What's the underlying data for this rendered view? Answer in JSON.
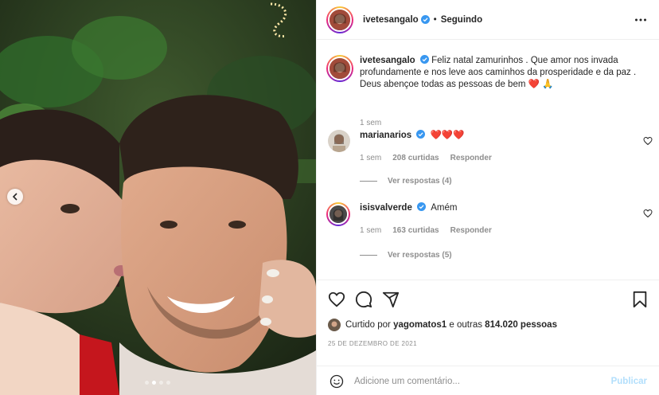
{
  "header": {
    "username": "ivetesangalo",
    "separator": "•",
    "following_label": "Seguindo"
  },
  "caption": {
    "username": "ivetesangalo",
    "text": "Feliz natal zamurinhos . Que amor nos invada profundamente e nos leve aos caminhos da prosperidade e da paz . Deus abençoe todas as pessoas de bem",
    "emojis": "❤️ 🙏",
    "time": "1 sem"
  },
  "comments": [
    {
      "username": "marianarios",
      "text": "❤️❤️❤️",
      "time": "1 sem",
      "likes": "208 curtidas",
      "reply_label": "Responder",
      "view_replies": "Ver respostas (4)"
    },
    {
      "username": "isisvalverde",
      "text": "Amém",
      "time": "1 sem",
      "likes": "163 curtidas",
      "reply_label": "Responder",
      "view_replies": "Ver respostas (5)"
    }
  ],
  "likes": {
    "prefix": "Curtido por",
    "user": "yagomatos1",
    "middle": "e outras",
    "count": "814.020 pessoas"
  },
  "date": "25 DE DEZEMBRO DE 2021",
  "add_comment": {
    "placeholder": "Adicione um comentário...",
    "publish_label": "Publicar"
  },
  "carousel": {
    "dots": 4,
    "active_dot": 1
  },
  "colors": {
    "verified": "#3897f0",
    "heart_red": "#ed4956",
    "publish_disabled": "#b2dffc",
    "muted_text": "#8e8e8e"
  },
  "icons": [
    "chevron-left-icon",
    "more-icon",
    "verified-icon",
    "heart-icon",
    "comment-icon",
    "share-icon",
    "bookmark-icon",
    "emoji-icon"
  ]
}
